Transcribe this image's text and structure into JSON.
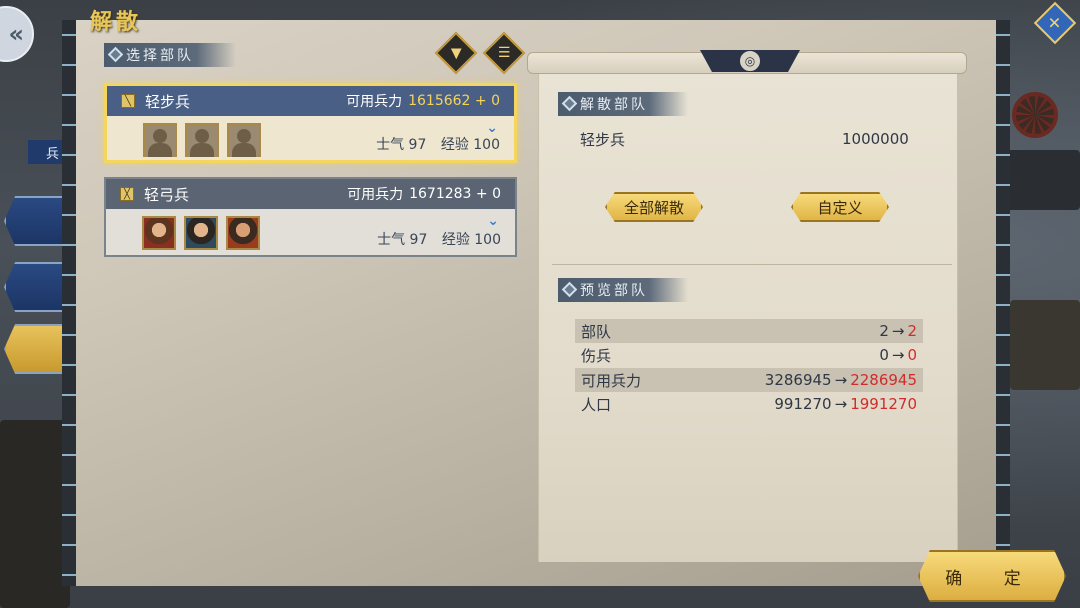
{
  "title": "解散",
  "side": {
    "label": "兵"
  },
  "select_section": {
    "header": "选择部队"
  },
  "icons": {
    "filter": "filter-icon",
    "list": "list-icon",
    "back": "back-chevron-icon",
    "corner": "crossed-flag-icon"
  },
  "units": [
    {
      "name": "轻步兵",
      "type_icon": "sword-icon",
      "avail_label": "可用兵力",
      "avail_value": "1615662 + 0",
      "morale": "士气 97",
      "exp": "经验 100",
      "selected": true
    },
    {
      "name": "轻弓兵",
      "type_icon": "bow-icon",
      "avail_label": "可用兵力",
      "avail_value": "1671283 + 0",
      "morale": "士气 97",
      "exp": "经验 100",
      "selected": false
    }
  ],
  "disband": {
    "header": "解散部队",
    "unit_name": "轻步兵",
    "amount": "1000000",
    "btn_all": "全部解散",
    "btn_custom": "自定义"
  },
  "preview": {
    "header": "预览部队",
    "rows": [
      {
        "label": "部队",
        "from": "2",
        "to": "2"
      },
      {
        "label": "伤兵",
        "from": "0",
        "to": "0"
      },
      {
        "label": "可用兵力",
        "from": "3286945",
        "to": "2286945"
      },
      {
        "label": "人口",
        "from": "991270",
        "to": "1991270"
      }
    ]
  },
  "confirm": "确 定",
  "colors": {
    "accent_gold": "#e7c65a",
    "highlight_red": "#d12b2b",
    "selected_border": "#f3d55f"
  }
}
